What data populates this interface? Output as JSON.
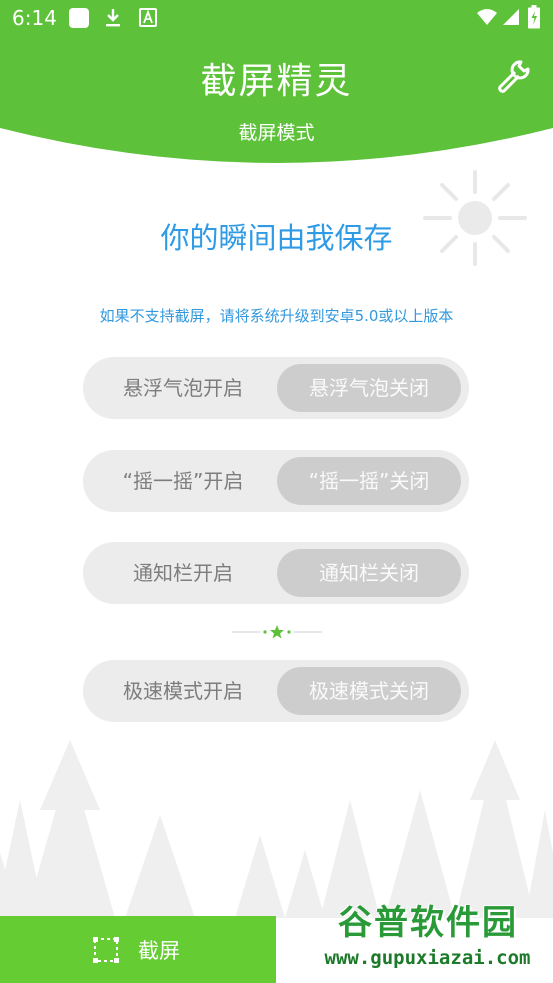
{
  "status_bar": {
    "time": "6:14",
    "icons": [
      "square-notification-icon",
      "download-icon",
      "font-a-icon",
      "wifi-icon",
      "signal-icon",
      "battery-icon"
    ]
  },
  "header": {
    "title": "截屏精灵",
    "subtitle": "截屏模式",
    "settings_icon": "wrench-icon",
    "color": "#5dc23a"
  },
  "main": {
    "slogan": "你的瞬间由我保存",
    "hint": "如果不支持截屏，请将系统升级到安卓5.0或以上版本",
    "toggles": [
      {
        "on_label": "悬浮气泡开启",
        "off_label": "悬浮气泡关闭",
        "selected": "off"
      },
      {
        "on_label": "“摇一摇”开启",
        "off_label": "“摇一摇”关闭",
        "selected": "off"
      },
      {
        "on_label": "通知栏开启",
        "off_label": "通知栏关闭",
        "selected": "off"
      },
      {
        "on_label": "极速模式开启",
        "off_label": "极速模式关闭",
        "selected": "off"
      }
    ]
  },
  "bottom": {
    "capture_label": "截屏",
    "capture_icon": "selection-frame-icon",
    "button_color": "#66cc33"
  },
  "watermark": {
    "main": "谷普软件园",
    "sub": "www.gupuxiazai.com"
  }
}
